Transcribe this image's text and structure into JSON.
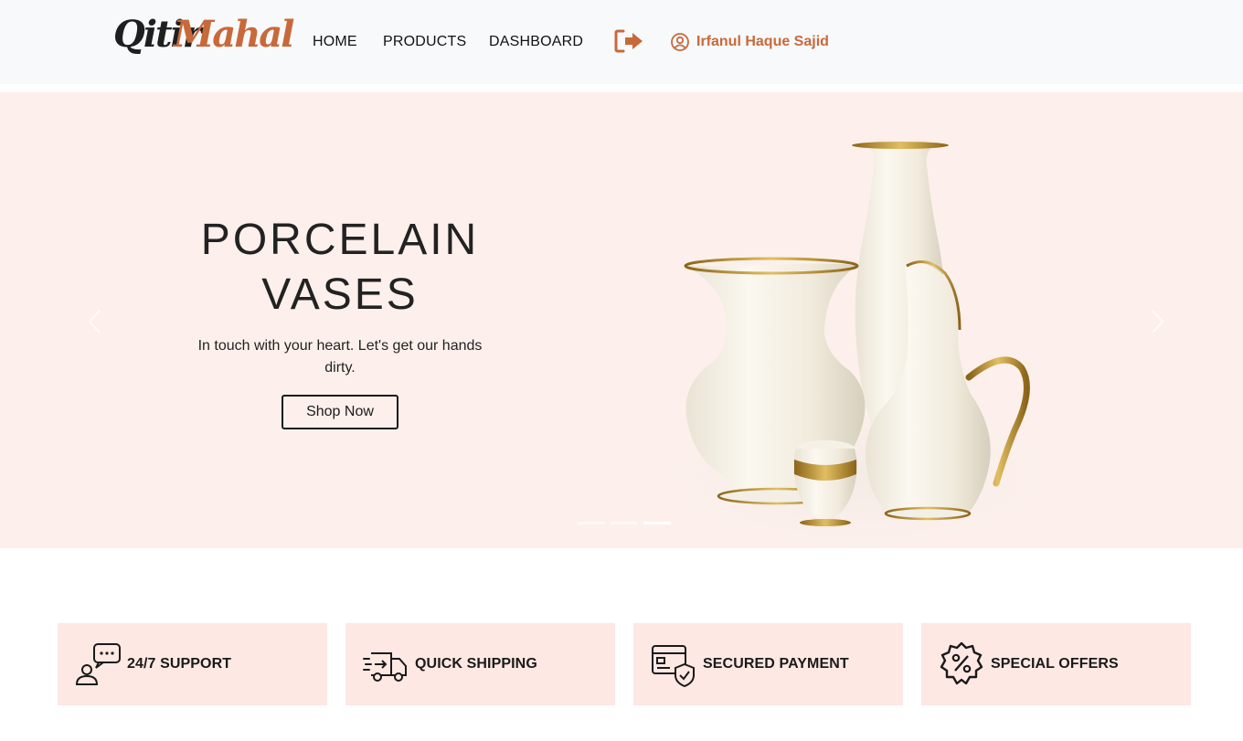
{
  "brand": {
    "logo_part1": "Qitir",
    "logo_part2": "Mahal",
    "accent_color": "#c8693a"
  },
  "nav": {
    "links": [
      {
        "label": "HOME"
      },
      {
        "label": "PRODUCTS"
      },
      {
        "label": "DASHBOARD"
      }
    ],
    "logout_icon": "logout-icon",
    "user_icon": "user-circle-icon",
    "user_name": "Irfanul Haque Sajid"
  },
  "hero": {
    "title_line1": "PORCELAIN",
    "title_line2": "VASES",
    "subtitle": "In touch with your heart. Let's get our hands dirty.",
    "button_label": "Shop Now",
    "background_color": "#fdf0ec",
    "slide_count": 3,
    "active_slide": 3
  },
  "features": [
    {
      "label": "24/7 SUPPORT",
      "icon": "support-chat-icon"
    },
    {
      "label": "QUICK SHIPPING",
      "icon": "delivery-truck-icon"
    },
    {
      "label": "SECURED PAYMENT",
      "icon": "secure-card-icon"
    },
    {
      "label": "SPECIAL OFFERS",
      "icon": "discount-badge-icon"
    }
  ]
}
